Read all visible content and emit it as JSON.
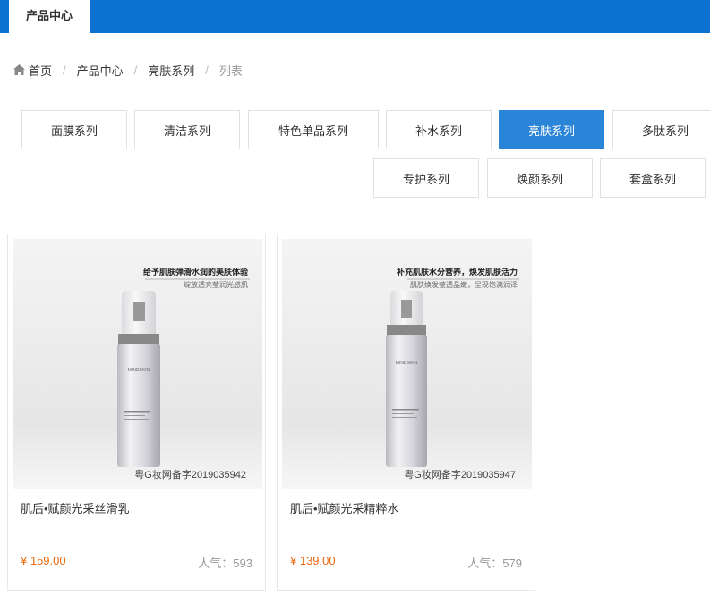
{
  "header": {
    "tab_label": "产品中心"
  },
  "breadcrumb": {
    "home": "首页",
    "items": [
      "产品中心",
      "亮肤系列"
    ],
    "current": "列表",
    "separator": "/"
  },
  "categories": [
    {
      "label": "面膜系列",
      "active": false
    },
    {
      "label": "清洁系列",
      "active": false
    },
    {
      "label": "特色单品系列",
      "active": false
    },
    {
      "label": "补水系列",
      "active": false
    },
    {
      "label": "亮肤系列",
      "active": true
    },
    {
      "label": "多肽系列",
      "active": false
    },
    {
      "label": "专护系列",
      "active": false
    },
    {
      "label": "焕颜系列",
      "active": false
    },
    {
      "label": "套盒系列",
      "active": false
    }
  ],
  "products": [
    {
      "name": "肌后•赋颜光采丝滑乳",
      "price": "¥ 159.00",
      "popularity": "人气：593",
      "image_slogan": "给予肌肤弹滑水润的美肤体验",
      "image_subslogan": "绽放透亮莹润光感肌",
      "image_reg": "粤G妆网备字2019035942",
      "brand_text": "MINDSKIN"
    },
    {
      "name": "肌后•赋颜光采精粹水",
      "price": "¥ 139.00",
      "popularity": "人气：579",
      "image_slogan": "补充肌肤水分营养，焕发肌肤活力",
      "image_subslogan": "肌肤焕发莹透晶嫩，呈现饱满润泽",
      "image_reg": "粤G妆网备字2019035947",
      "brand_text": "MINDSKIN"
    }
  ],
  "colors": {
    "brand_blue": "#0b72d2",
    "active_blue": "#2a84d7",
    "price_orange": "#e96a10"
  },
  "icons": {
    "home": "home-icon"
  }
}
